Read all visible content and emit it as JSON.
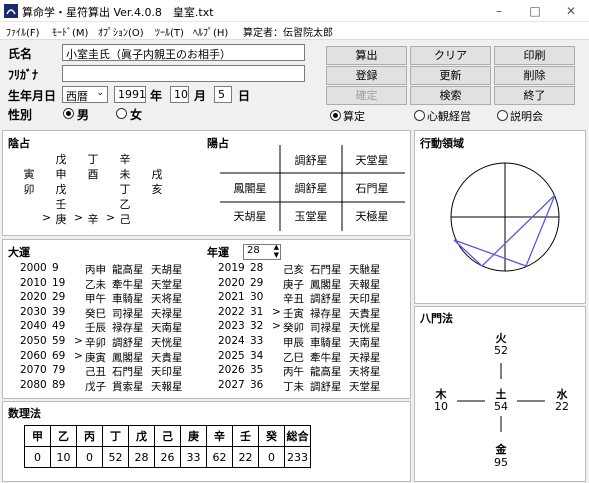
{
  "window": {
    "title": "算命学・星符算出 Ver.4.0.8　皇室.txt",
    "min": "–",
    "max": "□",
    "close": "✕"
  },
  "menu": [
    "ﾌｧｲﾙ(F)",
    "ﾓｰﾄﾞ(M)",
    "ｵﾌﾟｼｮﾝ(O)",
    "ﾂｰﾙ(T)",
    "ﾍﾙﾌﾟ(H)",
    "算定者：伝習院太郎"
  ],
  "form": {
    "name_label": "氏名",
    "name_value": "小室圭氏（眞子内親王のお相手）",
    "kana_label": "ﾌﾘｶﾞﾅ",
    "kana_value": "",
    "birth_label": "生年月日",
    "era": "西暦",
    "year": "1991",
    "year_unit": "年",
    "month": "10",
    "month_unit": "月",
    "day": "5",
    "day_unit": "日",
    "gender_label": "性別",
    "male": "男",
    "female": "女"
  },
  "buttons": [
    "算出",
    "クリア",
    "印刷",
    "登録",
    "更新",
    "削除",
    "確定",
    "検索",
    "終了"
  ],
  "modes": [
    "算定",
    "心観経営",
    "説明会"
  ],
  "inyo": {
    "title": "陰占",
    "rows": [
      [
        "",
        "戊",
        "丁",
        "辛",
        ""
      ],
      [
        "寅",
        "申",
        "酉",
        "未",
        "戌"
      ],
      [
        "卯",
        "戊",
        "",
        "丁",
        "亥"
      ],
      [
        "",
        "壬",
        "",
        "乙",
        ""
      ],
      [
        "",
        "庚",
        "辛",
        "己",
        ""
      ]
    ],
    "arrows": [
      ">",
      ">",
      ">"
    ]
  },
  "yosen": {
    "title": "陽占",
    "cells": [
      "調舒星",
      "天堂星",
      "鳳閣星",
      "調舒星",
      "石門星",
      "天胡星",
      "玉堂星",
      "天極星"
    ]
  },
  "kodo": {
    "title": "行動領域"
  },
  "taiun": {
    "title": "大運",
    "nen": "年運",
    "nen_value": "28",
    "left": [
      [
        "2000",
        "9",
        "",
        "丙申",
        "龍高星",
        "天胡星"
      ],
      [
        "2010",
        "19",
        "",
        "乙未",
        "牽牛星",
        "天堂星"
      ],
      [
        "2020",
        "29",
        "",
        "甲午",
        "車騎星",
        "天将星"
      ],
      [
        "2030",
        "39",
        "",
        "癸巳",
        "司禄星",
        "天禄星"
      ],
      [
        "2040",
        "49",
        "",
        "壬辰",
        "禄存星",
        "天南星"
      ],
      [
        "2050",
        "59",
        ">",
        "辛卯",
        "調舒星",
        "天恍星"
      ],
      [
        "2060",
        "69",
        ">",
        "庚寅",
        "鳳閣星",
        "天貴星"
      ],
      [
        "2070",
        "79",
        "",
        "己丑",
        "石門星",
        "天印星"
      ],
      [
        "2080",
        "89",
        "",
        "戊子",
        "貫索星",
        "天報星"
      ]
    ],
    "right": [
      [
        "2019",
        "28",
        "",
        "己亥",
        "石門星",
        "天馳星"
      ],
      [
        "2020",
        "29",
        "",
        "庚子",
        "鳳閣星",
        "天報星"
      ],
      [
        "2021",
        "30",
        "",
        "辛丑",
        "調舒星",
        "天印星"
      ],
      [
        "2022",
        "31",
        ">",
        "壬寅",
        "禄存星",
        "天貴星"
      ],
      [
        "2023",
        "32",
        ">",
        "癸卯",
        "司禄星",
        "天恍星"
      ],
      [
        "2024",
        "33",
        "",
        "甲辰",
        "車騎星",
        "天南星"
      ],
      [
        "2025",
        "34",
        "",
        "乙巳",
        "牽牛星",
        "天禄星"
      ],
      [
        "2026",
        "35",
        "",
        "丙午",
        "龍高星",
        "天将星"
      ],
      [
        "2027",
        "36",
        "",
        "丁未",
        "調舒星",
        "天堂星"
      ]
    ]
  },
  "hachimon": {
    "title": "八門法",
    "fire": "火",
    "fire_v": "52",
    "wood": "木",
    "wood_v": "10",
    "earth": "土",
    "earth_v": "54",
    "water": "水",
    "water_v": "22",
    "metal": "金",
    "metal_v": "95"
  },
  "suri": {
    "title": "数理法",
    "headers": [
      "甲",
      "乙",
      "丙",
      "丁",
      "戊",
      "己",
      "庚",
      "辛",
      "壬",
      "癸",
      "総合"
    ],
    "values": [
      "0",
      "10",
      "0",
      "52",
      "28",
      "26",
      "33",
      "62",
      "22",
      "0",
      "233"
    ]
  }
}
